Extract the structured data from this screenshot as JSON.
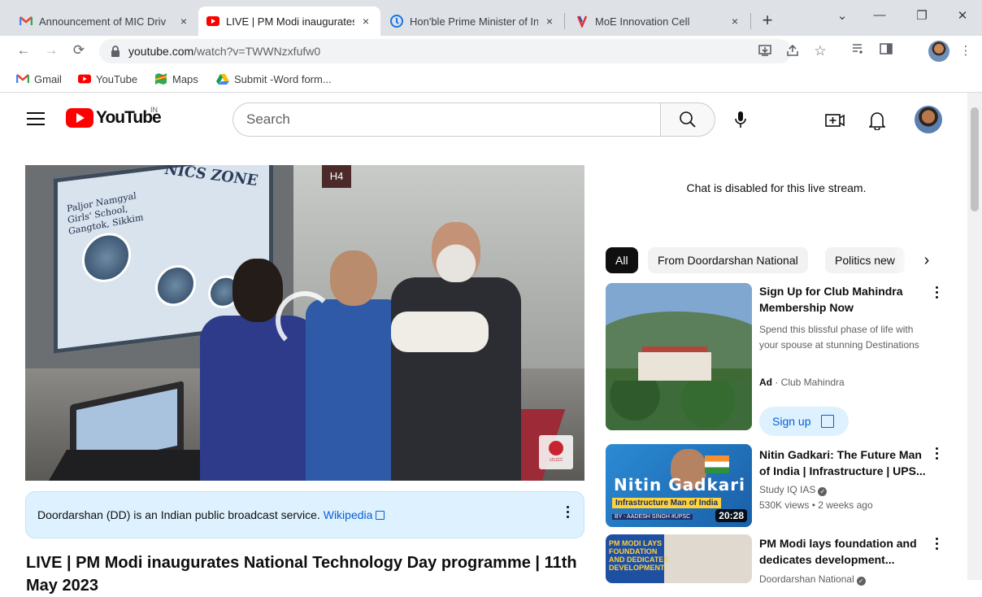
{
  "browser": {
    "tabs": [
      {
        "label": "Announcement of MIC Driv",
        "active": false,
        "icon": "gmail-icon"
      },
      {
        "label": "LIVE | PM Modi inaugurates",
        "active": true,
        "icon": "youtube-icon"
      },
      {
        "label": "Hon'ble Prime Minister of In",
        "active": false,
        "icon": "globe-icon"
      },
      {
        "label": "MoE Innovation Cell",
        "active": false,
        "icon": "moe-icon"
      }
    ],
    "tab_close": "×",
    "new_tab": "+",
    "window_controls": {
      "chevron": "⌄",
      "minimize": "—",
      "restore": "❐",
      "close": "✕"
    },
    "nav": {
      "back": "←",
      "forward": "→",
      "reload": "⟳"
    },
    "url_host": "youtube.com",
    "url_path": "/watch?v=TWWNzxfufw0",
    "bookmarks": [
      {
        "label": "Gmail",
        "icon": "gmail-icon"
      },
      {
        "label": "YouTube",
        "icon": "youtube-icon"
      },
      {
        "label": "Maps",
        "icon": "maps-icon"
      },
      {
        "label": "Submit -Word form...",
        "icon": "drive-icon"
      }
    ]
  },
  "youtube": {
    "logo_text": "YouTube",
    "country_code": "IN",
    "search_placeholder": "Search"
  },
  "player": {
    "board_heading": "NICS ZONE",
    "board_school": "Paljor Namgyal Girls' School, Gangtok, Sikkim",
    "hall_sign": "H4",
    "channel_watermark": "ಚಂದನ"
  },
  "info_panel": {
    "text": "Doordarshan (DD) is an Indian public broadcast service.",
    "link": "Wikipedia"
  },
  "video_title": "LIVE | PM Modi inaugurates National Technology Day programme | 11th May 2023",
  "chat_note": "Chat is disabled for this live stream.",
  "chips": [
    "All",
    "From Doordarshan National",
    "Politics new"
  ],
  "chip_next": "›",
  "recommendations": [
    {
      "title": "Sign Up for Club Mahindra Membership Now",
      "description": "Spend this blissful phase of life with your spouse at stunning Destinations",
      "ad_label": "Ad",
      "advertiser": "Club Mahindra",
      "cta": "Sign up"
    },
    {
      "title": "Nitin Gadkari: The Future Man of India | Infrastructure | UPS...",
      "channel": "Study IQ IAS",
      "views": "530K views",
      "age": "2 weeks ago",
      "duration": "20:28",
      "thumb_title": "Nitin Gadkari",
      "thumb_subtitle": "Infrastructure Man of India",
      "thumb_byline": "BY - AADESH SINGH  #UPSC"
    },
    {
      "title": "PM Modi lays foundation and dedicates development...",
      "channel": "Doordarshan National",
      "thumb_title": "PM MODI LAYS FOUNDATION AND DEDICATES DEVELOPMENT"
    }
  ],
  "colors": {
    "youtube_red": "#ff0000",
    "link_blue": "#065fd4",
    "info_bg": "#def1ff",
    "chip_selected": "#0f0f0f"
  }
}
